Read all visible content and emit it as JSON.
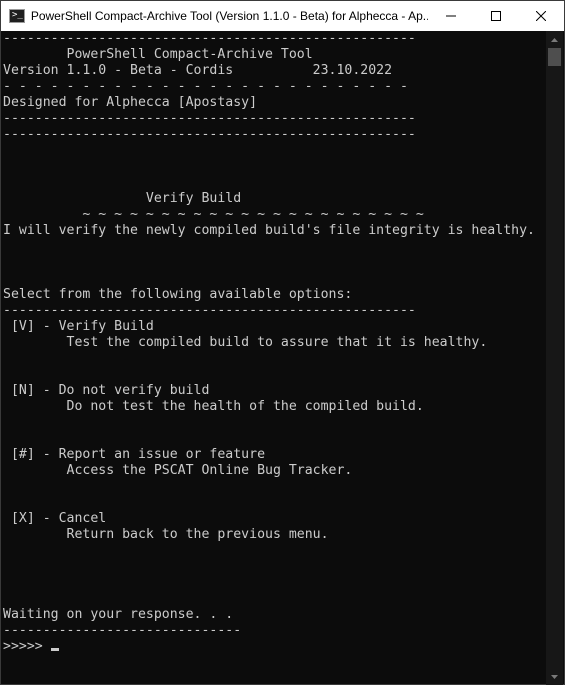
{
  "window": {
    "title": "PowerShell Compact-Archive Tool (Version 1.1.0 - Beta) for Alphecca - Ap...",
    "icon_label": ">_",
    "controls": [
      "minimize-icon",
      "maximize-icon",
      "close-icon"
    ]
  },
  "terminal": {
    "lines": [
      "----------------------------------------------------",
      "        PowerShell Compact-Archive Tool",
      "Version 1.1.0 - Beta - Cordis          23.10.2022",
      "- - - - - - - - - - - - - - - - - - - - - - - - - -",
      "Designed for Alphecca [Apostasy]",
      "----------------------------------------------------",
      "----------------------------------------------------",
      "",
      "",
      "",
      "                  Verify Build",
      "          ~ ~ ~ ~ ~ ~ ~ ~ ~ ~ ~ ~ ~ ~ ~ ~ ~ ~ ~ ~ ~ ~",
      "I will verify the newly compiled build's file integrity is healthy.",
      "",
      "",
      "",
      "Select from the following available options:",
      "----------------------------------------------------",
      " [V] - Verify Build",
      "        Test the compiled build to assure that it is healthy.",
      "",
      "",
      " [N] - Do not verify build",
      "        Do not test the health of the compiled build.",
      "",
      "",
      " [#] - Report an issue or feature",
      "        Access the PSCAT Online Bug Tracker.",
      "",
      "",
      " [X] - Cancel",
      "        Return back to the previous menu.",
      "",
      "",
      "",
      "",
      "Waiting on your response. . .",
      "------------------------------"
    ],
    "prompt": ">>>>> "
  },
  "colors": {
    "background": "#0c0c0c",
    "foreground": "#cccccc",
    "titlebar": "#ffffff"
  }
}
